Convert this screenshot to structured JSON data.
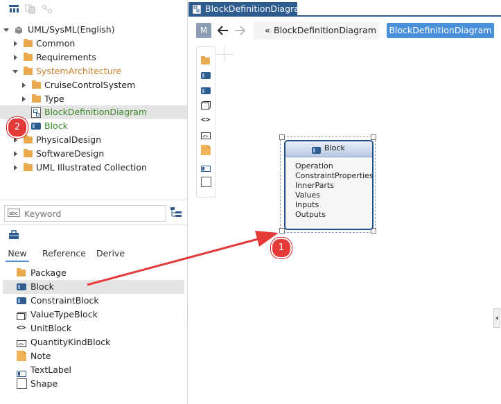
{
  "tree": {
    "root_label": "UML/SysML(English)",
    "items": [
      {
        "label": "Common"
      },
      {
        "label": "Requirements"
      },
      {
        "label": "SystemArchitecture"
      },
      {
        "label": "CruiseControlSystem"
      },
      {
        "label": "Type"
      },
      {
        "label": "BlockDefinitionDiagram"
      },
      {
        "label": "Block"
      },
      {
        "label": "PhysicalDesign"
      },
      {
        "label": "SoftwareDesign"
      },
      {
        "label": "UML Illustrated Collection"
      }
    ]
  },
  "search": {
    "placeholder": "Keyword"
  },
  "tabs": {
    "new": "New",
    "reference": "Reference",
    "derive": "Derive"
  },
  "palette_items": [
    {
      "label": "Package"
    },
    {
      "label": "Block"
    },
    {
      "label": "ConstraintBlock"
    },
    {
      "label": "ValueTypeBlock"
    },
    {
      "label": "UnitBlock"
    },
    {
      "label": "QuantityKindBlock"
    },
    {
      "label": "Note"
    },
    {
      "label": "TextLabel"
    },
    {
      "label": "Shape"
    }
  ],
  "editor": {
    "tab_title": "BlockDefinitionDiagram",
    "mode_letter": "M",
    "breadcrumb": "BlockDefinitionDiagram",
    "breadcrumb_prefix": "«",
    "current_button": "BlockDefinitionDiagram"
  },
  "block": {
    "title": "Block",
    "compartments": [
      "Operation",
      "ConstraintProperties",
      "InnerParts",
      "Values",
      "Inputs",
      "Outputs"
    ]
  },
  "badges": {
    "one": "1",
    "two": "2"
  },
  "colors": {
    "accent": "#4a90d9",
    "folder": "#e9a94f",
    "block": "#2f5c8f",
    "badge": "#e43a3a",
    "arrow": "#e43a3a"
  }
}
